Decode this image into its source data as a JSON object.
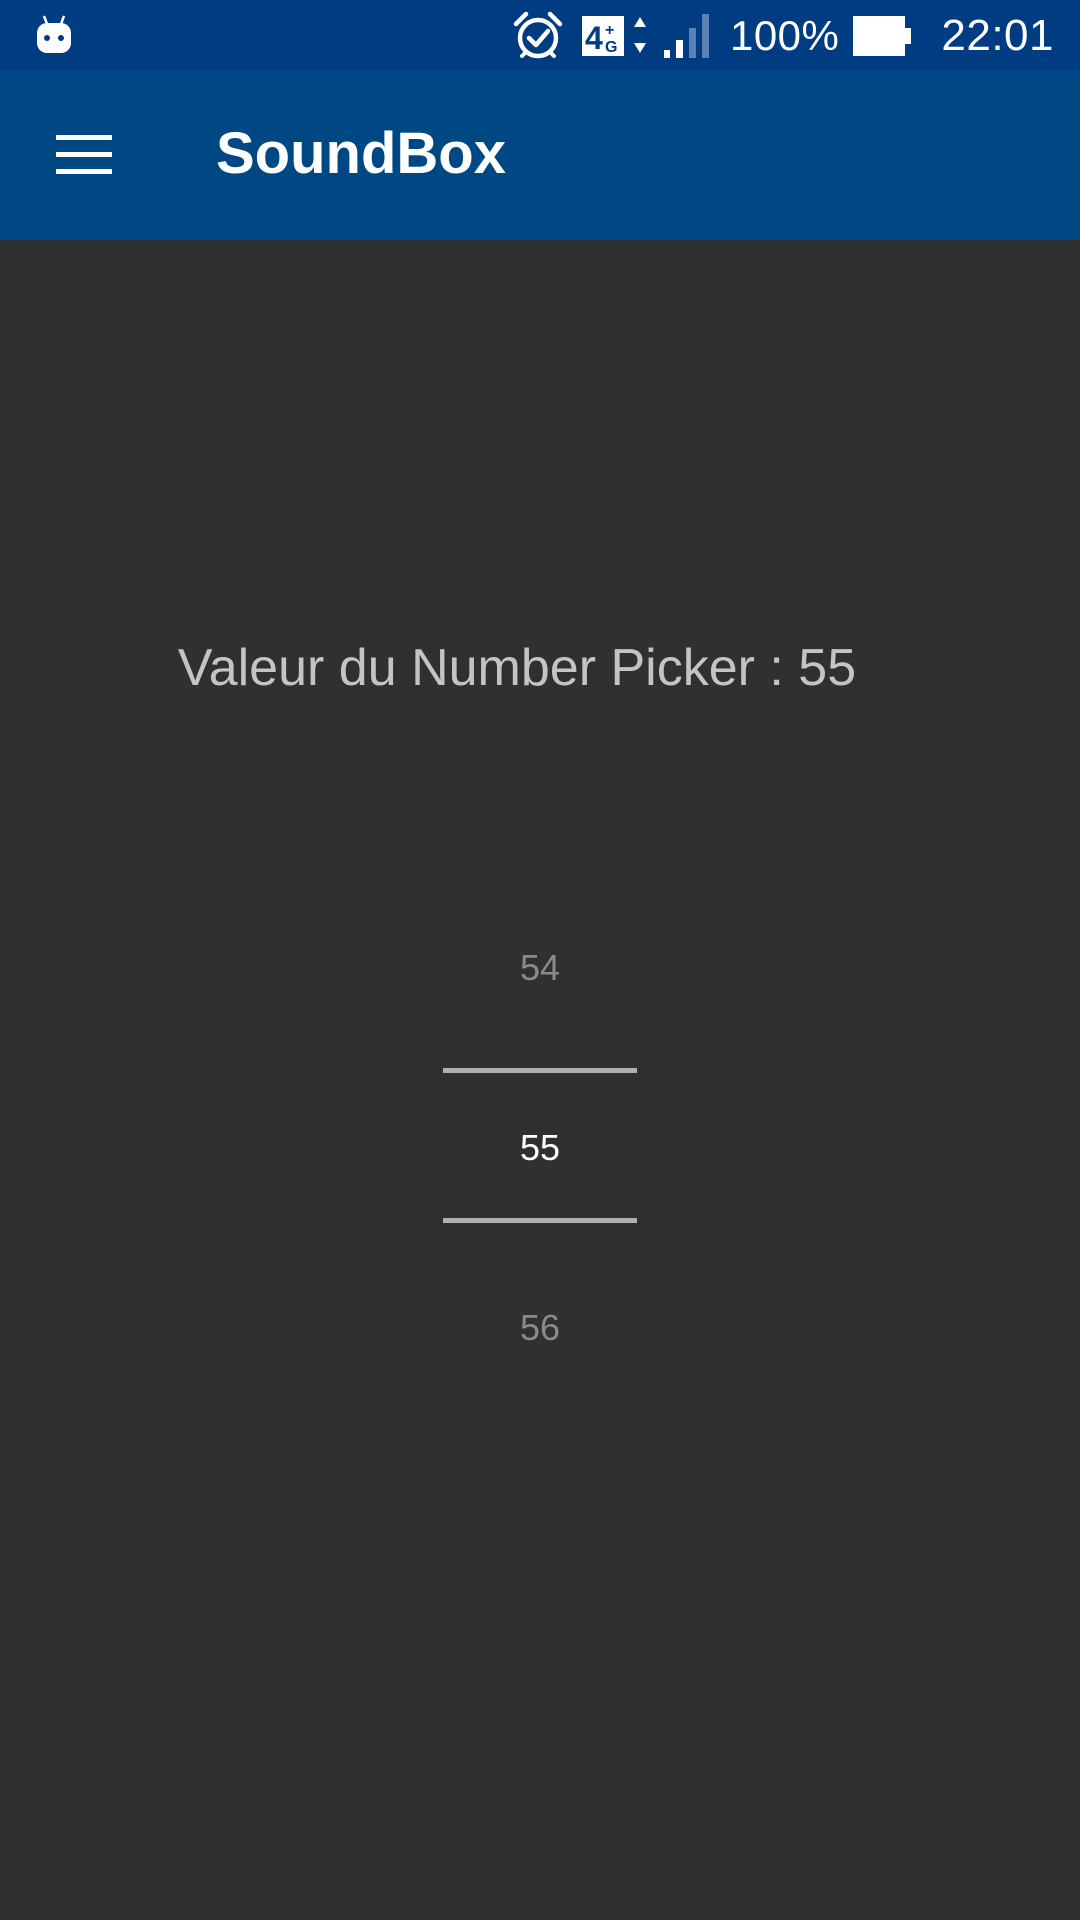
{
  "status_bar": {
    "notification_icon": "android-robot-icon",
    "alarm_icon": "alarm-clock-icon",
    "network_label": "4G",
    "signal_icon": "cell-signal-icon",
    "battery_percent": "100%",
    "battery_icon": "battery-icon",
    "time": "22:01",
    "background_color": "#003c82"
  },
  "app_bar": {
    "menu_icon": "hamburger-menu-icon",
    "title": "SoundBox",
    "background_color": "#004883"
  },
  "content": {
    "value_label": "Valeur du Number Picker : 55",
    "background_color": "#303030"
  },
  "number_picker": {
    "previous": "54",
    "current": "55",
    "next": "56"
  }
}
